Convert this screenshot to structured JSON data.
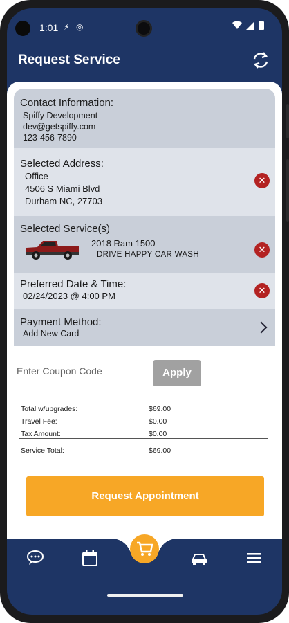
{
  "status_bar": {
    "time": "1:01"
  },
  "header": {
    "title": "Request Service",
    "refresh_icon": "refresh-icon"
  },
  "contact": {
    "title": "Contact Information:",
    "name": "Spiffy Development",
    "email": "dev@getspiffy.com",
    "phone": "123-456-7890"
  },
  "address": {
    "title": "Selected Address:",
    "label": "Office",
    "street": "4506 S Miami Blvd",
    "city": "Durham NC, 27703"
  },
  "service": {
    "title": "Selected Service(s)",
    "vehicle": "2018 Ram 1500",
    "package": "DRIVE HAPPY CAR WASH"
  },
  "datetime": {
    "title": "Preferred Date & Time:",
    "value": "02/24/2023 @ 4:00 PM"
  },
  "payment": {
    "title": "Payment Method:",
    "value": "Add New Card"
  },
  "coupon": {
    "placeholder": "Enter Coupon Code",
    "apply_label": "Apply"
  },
  "totals": {
    "rows": [
      {
        "label": "Total w/upgrades:",
        "value": "$69.00"
      },
      {
        "label": "Travel Fee:",
        "value": "$0.00"
      },
      {
        "label": "Tax Amount:",
        "value": "$0.00"
      }
    ],
    "service_total_label": "Service Total:",
    "service_total_value": "$69.00"
  },
  "cta": {
    "label": "Request Appointment"
  },
  "nav": {
    "items": [
      "chat-icon",
      "calendar-icon",
      "cart-icon",
      "car-icon",
      "menu-icon"
    ]
  },
  "colors": {
    "navy": "#1e3565",
    "orange": "#f7a726",
    "danger": "#b32222"
  }
}
